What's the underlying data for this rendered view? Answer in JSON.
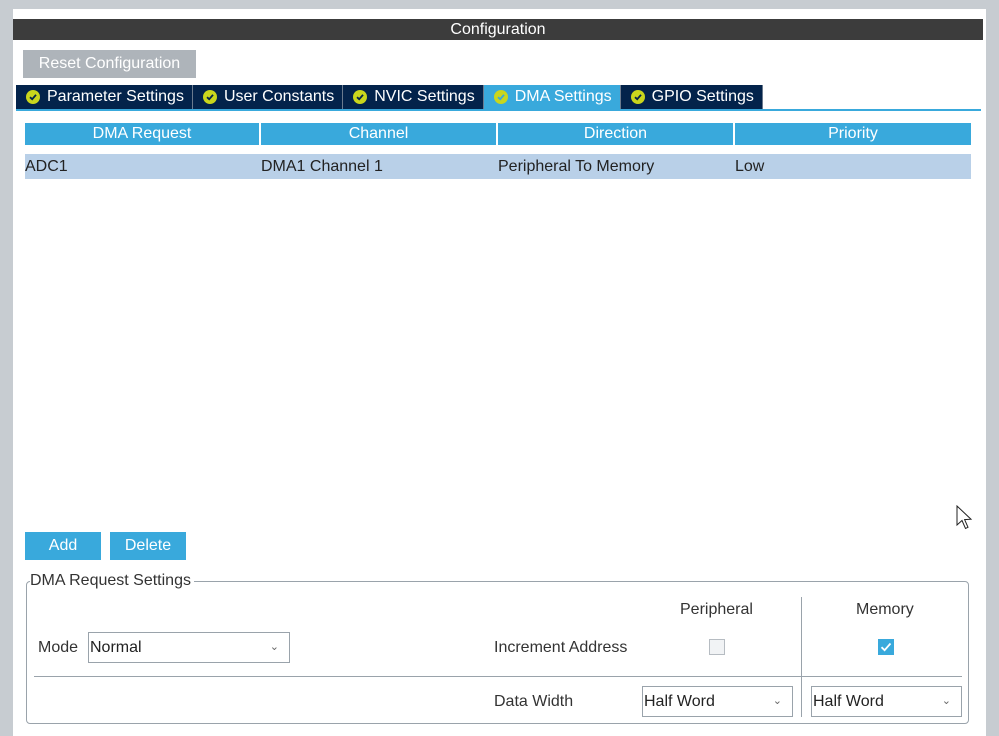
{
  "header": {
    "title": "Configuration"
  },
  "toolbar": {
    "reset_label": "Reset Configuration"
  },
  "tabs": [
    {
      "label": "Parameter Settings",
      "status_icon": "check-circle-icon",
      "active": false
    },
    {
      "label": "User Constants",
      "status_icon": "check-circle-icon",
      "active": false
    },
    {
      "label": "NVIC Settings",
      "status_icon": "check-circle-icon",
      "active": false
    },
    {
      "label": "DMA Settings",
      "status_icon": "check-circle-icon",
      "active": true
    },
    {
      "label": "GPIO Settings",
      "status_icon": "check-circle-icon",
      "active": false
    }
  ],
  "table": {
    "columns": [
      "DMA Request",
      "Channel",
      "Direction",
      "Priority"
    ],
    "rows": [
      [
        "ADC1",
        "DMA1 Channel 1",
        "Peripheral To Memory",
        "Low"
      ]
    ]
  },
  "actions": {
    "add_label": "Add",
    "delete_label": "Delete"
  },
  "settings": {
    "legend": "DMA Request Settings",
    "mode_label": "Mode",
    "mode_value": "Normal",
    "peripheral_header": "Peripheral",
    "memory_header": "Memory",
    "increment_label": "Increment Address",
    "peripheral_increment": false,
    "memory_increment": true,
    "data_width_label": "Data Width",
    "peripheral_width": "Half Word",
    "memory_width": "Half Word"
  },
  "colors": {
    "accent": "#39a9dc",
    "tab_bg": "#03234b",
    "title_bg": "#3c3c3c",
    "selected_row": "#b9d0e8",
    "status_ok": "#c9d61d"
  }
}
